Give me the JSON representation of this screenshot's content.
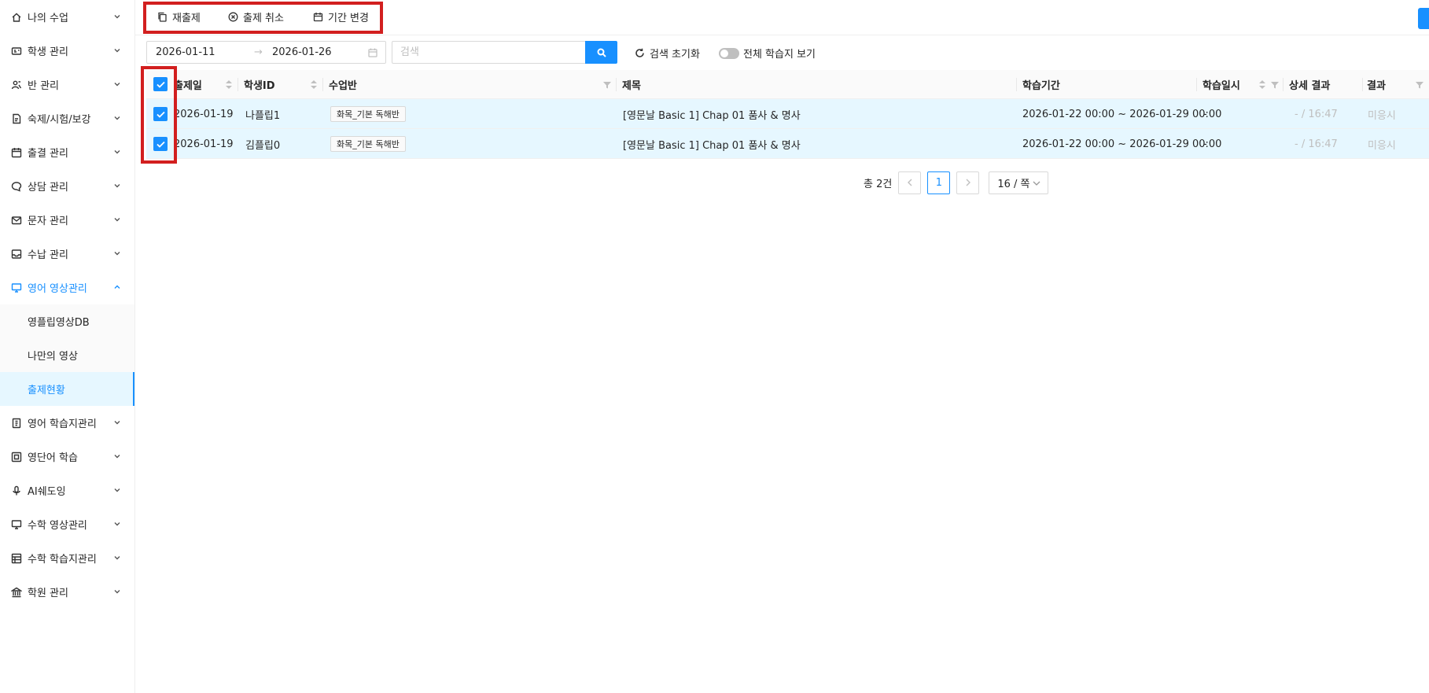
{
  "sidebar": {
    "items": [
      {
        "label": "나의 수업"
      },
      {
        "label": "학생 관리"
      },
      {
        "label": "반 관리"
      },
      {
        "label": "숙제/시험/보강"
      },
      {
        "label": "출결 관리"
      },
      {
        "label": "상담 관리"
      },
      {
        "label": "문자 관리"
      },
      {
        "label": "수납 관리"
      },
      {
        "label": "영어 영상관리"
      },
      {
        "label": "영어 학습지관리"
      },
      {
        "label": "영단어 학습"
      },
      {
        "label": "AI쉐도잉"
      },
      {
        "label": "수학 영상관리"
      },
      {
        "label": "수학 학습지관리"
      },
      {
        "label": "학원 관리"
      }
    ],
    "sub_items": [
      {
        "label": "영플립영상DB"
      },
      {
        "label": "나만의 영상"
      },
      {
        "label": "출제현황"
      }
    ]
  },
  "toolbar": {
    "reassign_label": "재출제",
    "cancel_label": "출제 취소",
    "change_period_label": "기간 변경"
  },
  "filters": {
    "start_date": "2026-01-11",
    "end_date": "2026-01-26",
    "range_separator": "→",
    "search_placeholder": "검색",
    "reset_label": "검색 초기화",
    "toggle_label": "전체 학습지 보기"
  },
  "table": {
    "columns": {
      "date": "출제일",
      "student_id": "학생ID",
      "class": "수업반",
      "title": "제목",
      "period": "학습기간",
      "study_time": "학습일시",
      "detail": "상세 결과",
      "result": "결과"
    },
    "rows": [
      {
        "date": "2026-01-19",
        "student_id": "나플립1",
        "class": "화목_기본 독해반",
        "title": "[영문날 Basic 1] Chap 01 품사 & 명사",
        "period": "2026-01-22 00:00 ~ 2026-01-29 00:00",
        "study_time": "-",
        "detail": "- / 16:47",
        "result": "미응시"
      },
      {
        "date": "2026-01-19",
        "student_id": "김플립0",
        "class": "화목_기본 독해반",
        "title": "[영문날 Basic 1] Chap 01 품사 & 명사",
        "period": "2026-01-22 00:00 ~ 2026-01-29 00:00",
        "study_time": "-",
        "detail": "- / 16:47",
        "result": "미응시"
      }
    ]
  },
  "pagination": {
    "total": "총 2건",
    "current_page": "1",
    "page_size": "16 / 쪽"
  },
  "colors": {
    "accent": "#1890ff",
    "highlight_box": "#d21f1f",
    "selected_row": "#e6f7ff"
  }
}
